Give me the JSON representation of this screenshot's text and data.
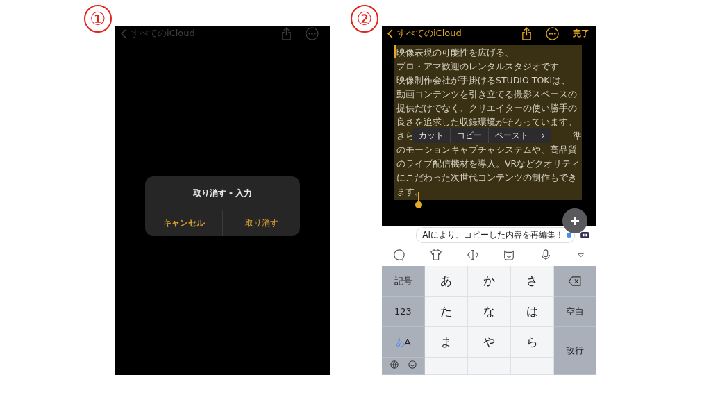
{
  "screen_1": {
    "step": "①",
    "nav": {
      "back": "すべてのiCloud",
      "dimmed": true
    },
    "alert": {
      "title": "取り消す - 入力",
      "buttons": [
        {
          "label": "キャンセル",
          "bold": true
        },
        {
          "label": "取り消す",
          "bold": false
        }
      ]
    }
  },
  "screen_2": {
    "step": "②",
    "nav": {
      "back": "すべてのiCloud",
      "dimmed": false,
      "done": "完了"
    },
    "note_lines": [
      {
        "kind": "text",
        "text": "映像表現の可能性を広げる、"
      },
      {
        "kind": "text",
        "text": "プロ・アマ歓迎のレンタルスタジオです"
      },
      {
        "kind": "text",
        "text": "映像制作会社が手掛けるSTUDIO TOKIは、"
      },
      {
        "kind": "text",
        "text": "動画コンテンツを引き立てる撮影スペースの"
      },
      {
        "kind": "text",
        "text": "提供だけでなく、クリエイターの使い勝手の"
      },
      {
        "kind": "text",
        "text": "良さを追求した収録環境がそろっています。"
      },
      {
        "kind": "covered",
        "left": "さら",
        "right": "準"
      },
      {
        "kind": "text",
        "text": "のモーションキャプチャシステムや、高品質"
      },
      {
        "kind": "text",
        "text": "のライブ配信機材を導入。VRなどクオリティ"
      },
      {
        "kind": "text",
        "text": "にこだわった次世代コンテンツの制作もでき"
      },
      {
        "kind": "text",
        "text": "ます。"
      }
    ],
    "edit_menu": [
      "カット",
      "コピー",
      "ペースト",
      "›"
    ],
    "suggestion": "AIにより、コピーした内容を再編集！",
    "keys": [
      {
        "kind": "fn",
        "label": "記号"
      },
      {
        "kind": "kana",
        "label": "あ"
      },
      {
        "kind": "kana",
        "label": "か"
      },
      {
        "kind": "kana",
        "label": "さ"
      },
      {
        "kind": "delete"
      },
      {
        "kind": "fn",
        "label": "123"
      },
      {
        "kind": "kana",
        "label": "た"
      },
      {
        "kind": "kana",
        "label": "な"
      },
      {
        "kind": "kana",
        "label": "は"
      },
      {
        "kind": "fn",
        "label": "空白"
      },
      {
        "kind": "mode",
        "label": "あ",
        "label2": "A"
      },
      {
        "kind": "kana",
        "label": "ま"
      },
      {
        "kind": "kana",
        "label": "や"
      },
      {
        "kind": "kana",
        "label": "ら"
      },
      {
        "kind": "return",
        "label": "改行"
      }
    ]
  }
}
